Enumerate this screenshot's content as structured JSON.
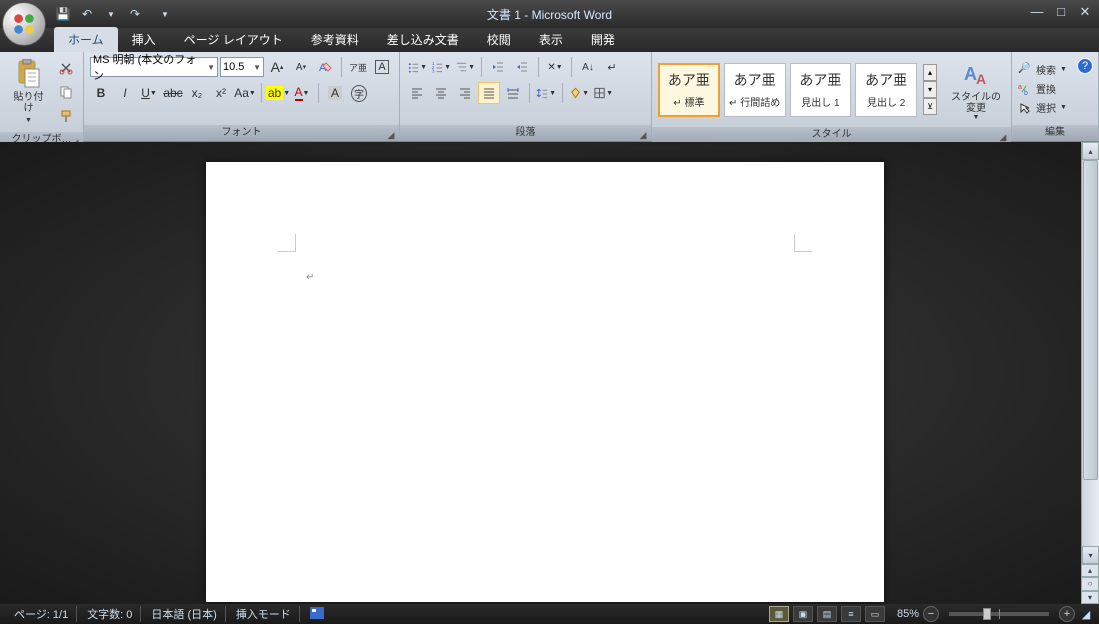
{
  "title": "文書 1 - Microsoft Word",
  "qat": {
    "save": "💾",
    "undo": "↶",
    "redo": "↷"
  },
  "tabs": [
    "ホーム",
    "挿入",
    "ページ レイアウト",
    "参考資料",
    "差し込み文書",
    "校閲",
    "表示",
    "開発"
  ],
  "active_tab": 0,
  "ribbon": {
    "clipboard": {
      "label": "クリップボ…",
      "paste": "貼り付け"
    },
    "font": {
      "label": "フォント",
      "name": "MS 明朝 (本文のフォン",
      "size": "10.5",
      "grow": "A",
      "shrink": "A",
      "clear": "㋐",
      "phonetic": "ア亜",
      "charborder": "A",
      "bold": "B",
      "italic": "I",
      "underline": "U",
      "strike": "abc",
      "sub": "x₂",
      "sup": "x²",
      "case": "Aa",
      "highlight": "ab",
      "color": "A",
      "charshade": "A",
      "circled": "㊁"
    },
    "paragraph": {
      "label": "段落",
      "bullets": "•",
      "numbers": "1.",
      "multilevel": "≡",
      "dedent": "⇤",
      "indent": "⇥",
      "sort": "A↓",
      "asian": "✕",
      "marks": "¶",
      "alignL": "≡",
      "alignC": "≡",
      "alignR": "≡",
      "alignJ": "≡",
      "distribute": "≡",
      "linespace": "↕",
      "shade": "◇",
      "border": "⊞"
    },
    "styles": {
      "label": "スタイル",
      "items": [
        {
          "preview": "あア亜",
          "name": "↵ 標準",
          "selected": true
        },
        {
          "preview": "あア亜",
          "name": "↵ 行間詰め",
          "selected": false
        },
        {
          "preview": "あア亜",
          "name": "見出し 1",
          "selected": false
        },
        {
          "preview": "あア亜",
          "name": "見出し 2",
          "selected": false
        }
      ],
      "change": "スタイルの\n変更"
    },
    "editing": {
      "label": "編集",
      "find": "検索",
      "replace": "置換",
      "select": "選択"
    }
  },
  "statusbar": {
    "page": "ページ: 1/1",
    "words": "文字数: 0",
    "lang": "日本語 (日本)",
    "mode": "挿入モード",
    "zoom": "85%"
  }
}
